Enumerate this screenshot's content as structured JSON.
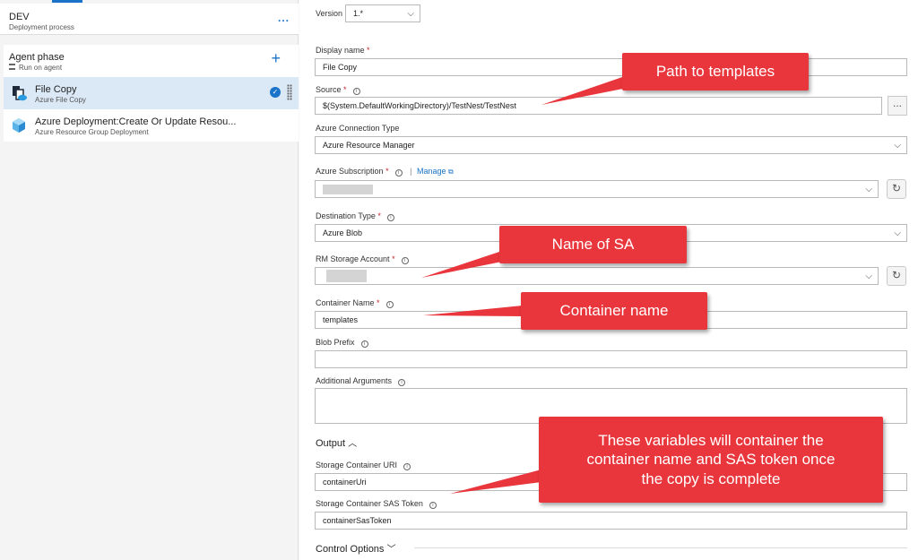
{
  "left": {
    "stage": {
      "name": "DEV",
      "subtitle": "Deployment process",
      "more": "..."
    },
    "phase": {
      "name": "Agent phase",
      "subtitle": "Run on agent",
      "add": "+"
    },
    "tasks": [
      {
        "name": "File Copy",
        "subtitle": "Azure File Copy",
        "selected": true
      },
      {
        "name": "Azure Deployment:Create Or Update Resou...",
        "subtitle": "Azure Resource Group Deployment",
        "selected": false
      }
    ]
  },
  "form": {
    "version": {
      "label": "Version",
      "value": "1.*"
    },
    "display_name": {
      "label": "Display name",
      "req": "*",
      "value": "File Copy"
    },
    "source": {
      "label": "Source",
      "req": "*",
      "value": "$(System.DefaultWorkingDirectory)/TestNest/TestNest",
      "browse": "..."
    },
    "connection_type": {
      "label": "Azure Connection Type",
      "value": "Azure Resource Manager"
    },
    "subscription": {
      "label": "Azure Subscription",
      "req": "*",
      "sep": "|",
      "manage": "Manage",
      "value": ""
    },
    "destination_type": {
      "label": "Destination Type",
      "req": "*",
      "value": "Azure Blob"
    },
    "storage_account": {
      "label": "RM Storage Account",
      "req": "*",
      "value": ""
    },
    "container_name": {
      "label": "Container Name",
      "req": "*",
      "value": "templates"
    },
    "blob_prefix": {
      "label": "Blob Prefix",
      "value": ""
    },
    "additional_args": {
      "label": "Additional Arguments",
      "value": ""
    },
    "output_section": "Output",
    "container_uri": {
      "label": "Storage Container URI",
      "value": "containerUri"
    },
    "sas_token": {
      "label": "Storage Container SAS Token",
      "value": "containerSasToken"
    },
    "control_options": "Control Options"
  },
  "callouts": {
    "templates": "Path to templates",
    "sa": "Name of SA",
    "container": "Container name",
    "variables": "These variables will container the container name and SAS token once the copy is complete"
  },
  "colors": {
    "accent": "#1a73c8",
    "callout": "#e8363c",
    "required": "#c4262e",
    "selected": "#dbe8f6"
  },
  "icons": [
    "more-icon",
    "plus-icon",
    "file-copy-icon",
    "check-icon",
    "grip-icon",
    "resource-group-icon",
    "info-icon",
    "chevron-down-icon",
    "chevron-up-icon",
    "refresh-icon",
    "external-link-icon"
  ]
}
